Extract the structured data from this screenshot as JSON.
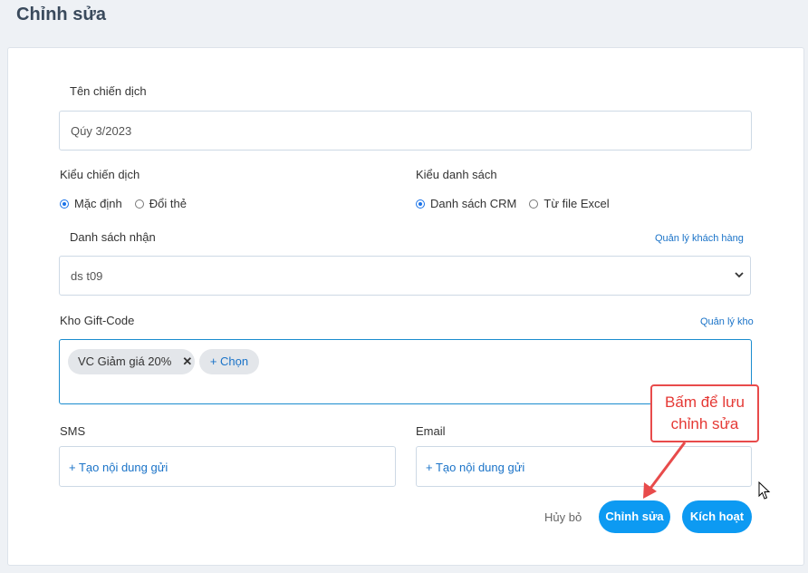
{
  "page": {
    "title": "Chỉnh sửa"
  },
  "campaign_name": {
    "label": "Tên chiến dịch",
    "value": "Qúy 3/2023"
  },
  "campaign_type": {
    "label": "Kiểu chiến dịch",
    "options": [
      "Mặc định",
      "Đổi thẻ"
    ],
    "selected": "Mặc định"
  },
  "list_type": {
    "label": "Kiểu danh sách",
    "options": [
      "Danh sách CRM",
      "Từ file Excel"
    ],
    "selected": "Danh sách CRM"
  },
  "recipients": {
    "label": "Danh sách nhận",
    "manage_link": "Quản lý khách hàng",
    "value": "ds t09"
  },
  "giftcode": {
    "label": "Kho Gift-Code",
    "manage_link": "Quản lý kho",
    "tags": [
      "VC Giảm giá 20%"
    ],
    "tag_remove_icon": "close-icon",
    "add_button": "+ Chọn"
  },
  "sms": {
    "label": "SMS",
    "create_link": "+ Tạo nội dung gửi"
  },
  "email": {
    "label": "Email",
    "create_link": "+ Tạo nội dung gửi"
  },
  "actions": {
    "cancel": "Hủy bỏ",
    "edit": "Chỉnh sửa",
    "activate": "Kích hoạt"
  },
  "annotation": {
    "line1": "Bấm để lưu",
    "line2": "chỉnh sửa"
  },
  "colors": {
    "primary": "#0d9af2",
    "link": "#1a73c8",
    "annotation": "#e53935",
    "background": "#eef1f5"
  }
}
